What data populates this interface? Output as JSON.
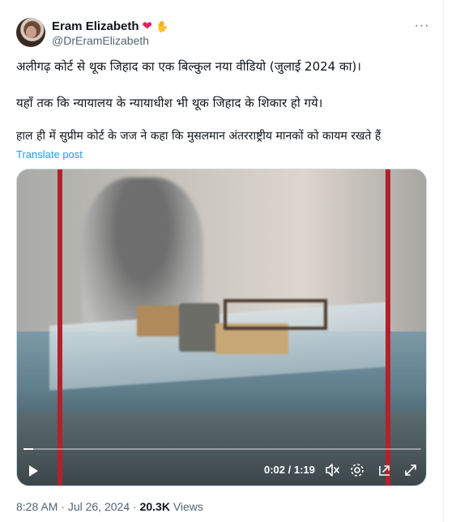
{
  "post": {
    "author_name": "Eram Elizabeth",
    "author_handle": "@DrEramElizabeth",
    "more_label": "···",
    "lines": [
      "अलीगढ़ कोर्ट से थूक जिहाद का एक बिल्कुल नया वीडियो (जुलाई 2024 का)।",
      "यहाँ तक कि न्यायालय के न्यायाधीश भी थूक जिहाद के शिकार हो गये।",
      "हाल ही में सुप्रीम कोर्ट के जज ने कहा कि मुसलमान अंतरराष्ट्रीय मानकों को कायम रखते हैं"
    ],
    "translate_label": "Translate post"
  },
  "video": {
    "time_display": "0:02 / 1:19",
    "progress": 0.025
  },
  "footer": {
    "time": "8:28 AM",
    "separator": "·",
    "date": "Jul 26, 2024",
    "views_count": "20.3K",
    "views_label": "Views"
  },
  "icons": {
    "verified_heart": "heart-icon",
    "hands": "handshake-icon",
    "more": "more-icon",
    "play": "play-icon",
    "mute": "mute-icon",
    "settings": "gear-icon",
    "pip": "pip-icon",
    "fullscreen": "fullscreen-icon"
  },
  "colors": {
    "accent": "#1d9bf0",
    "muted": "#536471",
    "text": "#0f1419",
    "heart": "#e0245e"
  }
}
